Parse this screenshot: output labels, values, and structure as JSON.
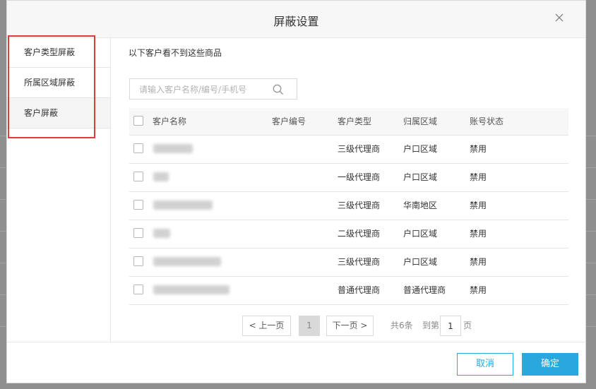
{
  "dialog": {
    "title": "屏蔽设置"
  },
  "sidebar": {
    "items": [
      {
        "label": "客户类型屏蔽"
      },
      {
        "label": "所属区域屏蔽"
      },
      {
        "label": "客户屏蔽"
      }
    ]
  },
  "main": {
    "hint": "以下客户看不到这些商品",
    "search": {
      "placeholder": "请输入客户名称/编号/手机号"
    }
  },
  "table": {
    "headers": [
      "客户名称",
      "客户编号",
      "客户类型",
      "归属区域",
      "账号状态"
    ],
    "rows": [
      {
        "type": "三级代理商",
        "region": "户口区域",
        "status": "禁用"
      },
      {
        "type": "一级代理商",
        "region": "户口区域",
        "status": "禁用"
      },
      {
        "type": "三级代理商",
        "region": "华南地区",
        "status": "禁用"
      },
      {
        "type": "二级代理商",
        "region": "户口区域",
        "status": "禁用"
      },
      {
        "type": "三级代理商",
        "region": "户口区域",
        "status": "禁用"
      },
      {
        "type": "普通代理商",
        "region": "普通代理商",
        "status": "禁用"
      }
    ]
  },
  "pagination": {
    "prev": "< 上一页",
    "page": "1",
    "next": "下一页 >",
    "total": "共6条",
    "goto": "到第",
    "goto_value": "1",
    "page_unit": "页"
  },
  "footer": {
    "cancel": "取消",
    "ok": "确定"
  },
  "colors": {
    "accent": "#29a8e0",
    "highlight": "#e03b3b"
  },
  "icons": {
    "close": "close-icon",
    "search": "search-icon"
  }
}
